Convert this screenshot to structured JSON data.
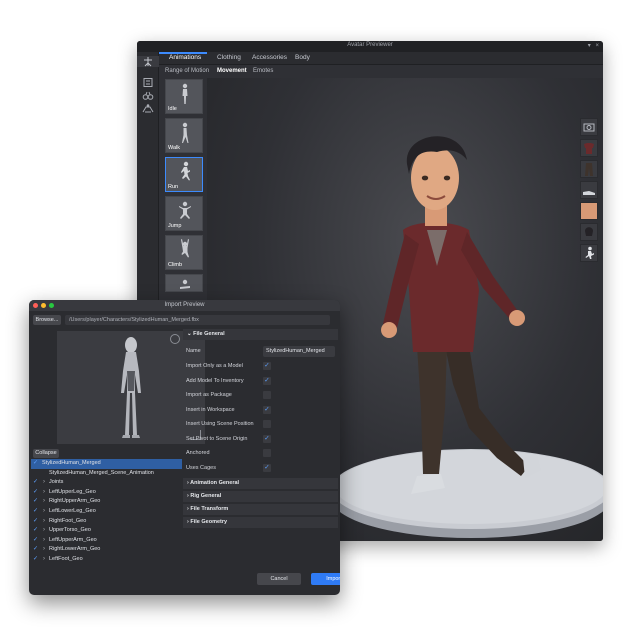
{
  "avatar_window": {
    "title": "Avatar Previewer",
    "window_controls": [
      "▾",
      "×"
    ],
    "tabs": [
      "Animations",
      "Clothing",
      "Accessories",
      "Body"
    ],
    "subtabs": [
      "Range of Motion",
      "Movement",
      "Emotes"
    ],
    "animations": [
      "Idle",
      "Walk",
      "Run",
      "Jump",
      "Climb",
      ""
    ],
    "selected_animation": "Run",
    "tools": [
      "animation-icon",
      "grid-icon",
      "binoculars-icon",
      "body-icon"
    ],
    "swatch_icons": [
      "camera-icon",
      "shirt-icon",
      "pants-icon",
      "shoes-icon",
      "skin-tone-icon",
      "head-icon",
      "pose-icon"
    ],
    "colors": {
      "accent": "#3d8bfd",
      "skin": "#d89a76",
      "shirt": "#6b2a2c",
      "pants": "#3e332c",
      "background": "#2f3035"
    }
  },
  "import_dialog": {
    "title": "Import Preview",
    "browse_label": "Browse...",
    "path": "/Users/player/Characters/StylizedHuman_Merged.fbx",
    "collapse_label": "Collapse",
    "tree": [
      {
        "label": "StylizedHuman_Merged",
        "checked": true,
        "chevron": false,
        "indent": 0,
        "selected": true
      },
      {
        "label": "StylizedHuman_Merged_Scene_Animation",
        "checked": false,
        "chevron": false,
        "indent": 1,
        "selected": false
      },
      {
        "label": "Joints",
        "checked": true,
        "chevron": true,
        "indent": 1,
        "selected": false
      },
      {
        "label": "LeftUpperLeg_Geo",
        "checked": true,
        "chevron": true,
        "indent": 1,
        "selected": false
      },
      {
        "label": "RightUpperArm_Geo",
        "checked": true,
        "chevron": true,
        "indent": 1,
        "selected": false
      },
      {
        "label": "LeftLowerLeg_Geo",
        "checked": true,
        "chevron": true,
        "indent": 1,
        "selected": false
      },
      {
        "label": "RightFoot_Geo",
        "checked": true,
        "chevron": true,
        "indent": 1,
        "selected": false
      },
      {
        "label": "UpperTorso_Geo",
        "checked": true,
        "chevron": true,
        "indent": 1,
        "selected": false
      },
      {
        "label": "LeftUpperArm_Geo",
        "checked": true,
        "chevron": true,
        "indent": 1,
        "selected": false
      },
      {
        "label": "RightLowerArm_Geo",
        "checked": true,
        "chevron": true,
        "indent": 1,
        "selected": false
      },
      {
        "label": "LeftFoot_Geo",
        "checked": true,
        "chevron": true,
        "indent": 1,
        "selected": false
      }
    ],
    "sections": {
      "file_general": "File General",
      "animation_general": "Animation General",
      "rig_general": "Rig General",
      "file_transform": "File Transform",
      "file_geometry": "File Geometry"
    },
    "name_label": "Name",
    "name_value": "StylizedHuman_Merged",
    "options": [
      {
        "label": "Import Only as a Model",
        "checked": true
      },
      {
        "label": "Add Model To Inventory",
        "checked": true
      },
      {
        "label": "Import as Package",
        "checked": false
      },
      {
        "label": "Insert in Workspace",
        "checked": true
      },
      {
        "label": "Insert Using Scene Position",
        "checked": false
      },
      {
        "label": "Set Pivot to Scene Origin",
        "checked": true
      },
      {
        "label": "Anchored",
        "checked": false
      },
      {
        "label": "Uses Cages",
        "checked": true
      }
    ],
    "cancel_label": "Cancel",
    "import_label": "Import",
    "colors": {
      "import_button": "#2f7bf5",
      "selection": "#2f5fa3",
      "check": "#5ea1ff"
    }
  }
}
